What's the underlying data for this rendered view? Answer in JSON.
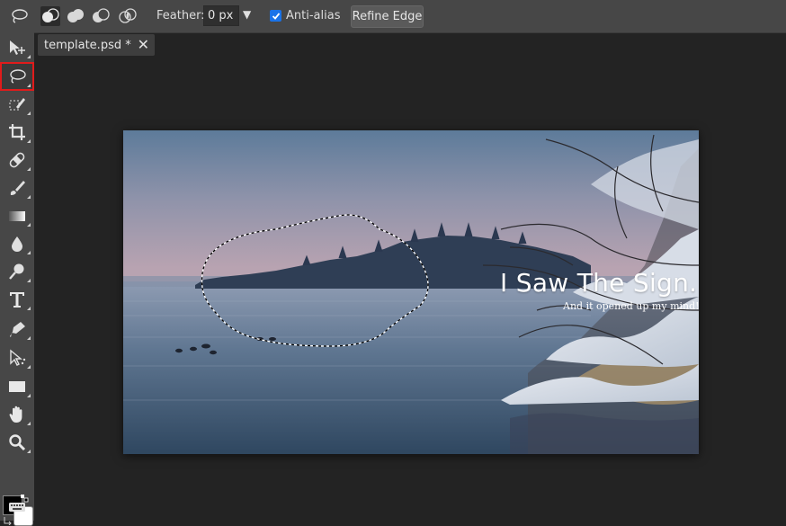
{
  "options_bar": {
    "feather_label": "Feather:",
    "feather_value": "0 px",
    "antialias_label": "Anti-alias",
    "antialias_checked": true,
    "refine_edge_label": "Refine Edge",
    "tool_icon": "lasso-icon",
    "mode_icons": [
      "new-selection-icon",
      "add-to-selection-icon",
      "subtract-from-selection-icon",
      "intersect-selection-icon"
    ]
  },
  "document": {
    "tab_label": "template.psd *",
    "close_label": "✕"
  },
  "canvas": {
    "headline": "I Saw The Sign.",
    "subline": "And it opened up my mind!"
  },
  "toolbar": {
    "selected_tool": "lasso-tool",
    "tools": [
      "move-tool",
      "lasso-tool",
      "quick-selection-tool",
      "crop-tool",
      "healing-tool",
      "brush-tool",
      "gradient-tool",
      "blur-tool",
      "dodge-tool",
      "type-tool",
      "pen-tool",
      "path-select-tool",
      "rectangle-tool",
      "hand-tool",
      "zoom-tool"
    ],
    "foreground_color": "#000000",
    "background_color": "#ffffff"
  },
  "colors": {
    "accent": "#1a73e8",
    "selected_outline": "#e01b1b"
  }
}
